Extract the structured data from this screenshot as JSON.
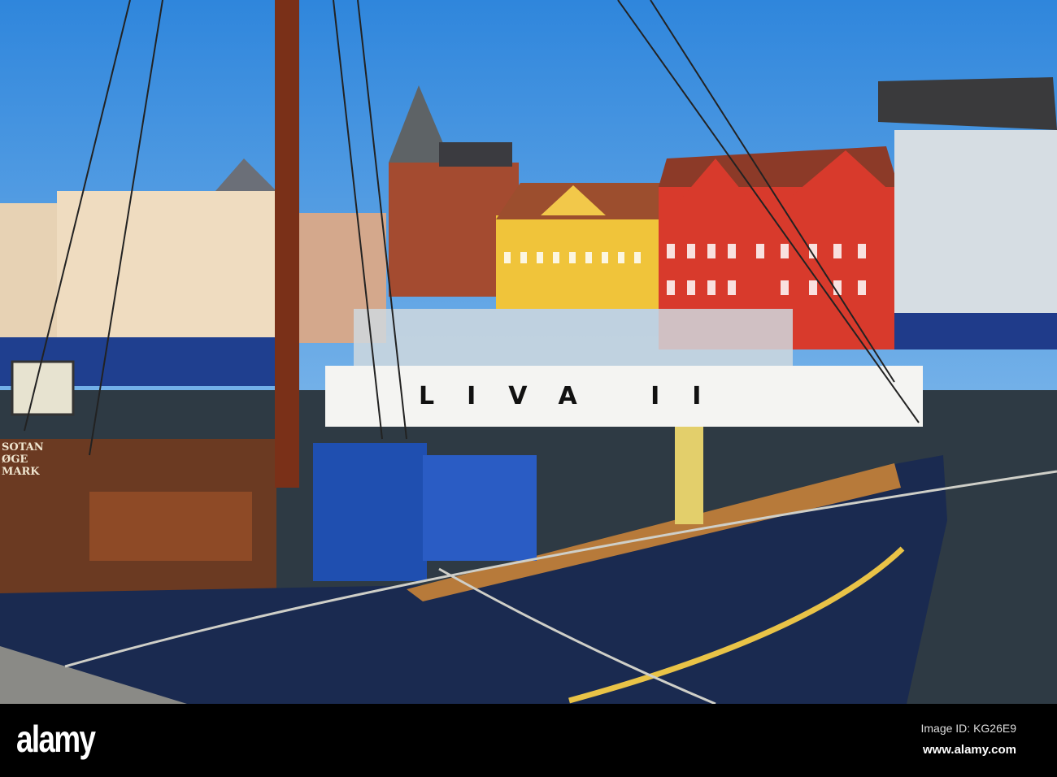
{
  "photo": {
    "boat_name": "LIVA II",
    "sign_text": "SOTAN ØGE MARK",
    "colors": {
      "sky": "#4a9be0",
      "red_building": "#d83a2c",
      "yellow_building": "#f0c43a",
      "hull": "#1a2a50",
      "tarp": "#1f4fb0",
      "water": "#2e3a44"
    }
  },
  "watermark": {
    "logo": "alamy",
    "image_id": "Image ID: KG26E9",
    "website": "www.alamy.com"
  }
}
